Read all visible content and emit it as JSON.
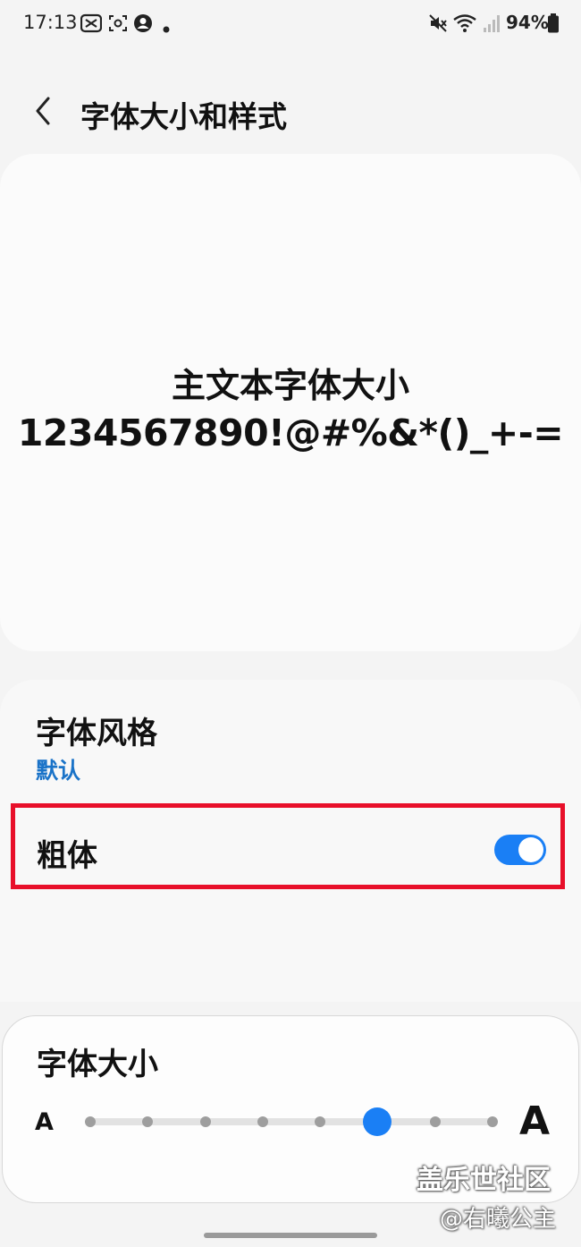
{
  "status_bar": {
    "time": "17:13",
    "battery_percent": "94%",
    "icons": [
      "capcut-icon",
      "screen-record-icon",
      "account-circle-icon",
      "dot-icon",
      "mute-icon",
      "wifi-icon",
      "signal-icon",
      "battery-icon"
    ]
  },
  "header": {
    "back_icon": "chevron-left-icon",
    "title": "字体大小和样式"
  },
  "preview": {
    "line1": "主文本字体大小",
    "line2": "1234567890!@#%&*()_+-="
  },
  "font_style": {
    "title": "字体风格",
    "value": "默认"
  },
  "bold": {
    "label": "粗体",
    "enabled": true
  },
  "font_size": {
    "title": "字体大小",
    "small_label": "A",
    "large_label": "A",
    "steps": 8,
    "selected_step": 6
  },
  "watermark": {
    "line1": "盖乐世社区",
    "line2": "@右曦公主"
  },
  "colors": {
    "accent": "#1a7ff5",
    "link": "#1a73c8",
    "highlight_border": "#e8102a"
  }
}
